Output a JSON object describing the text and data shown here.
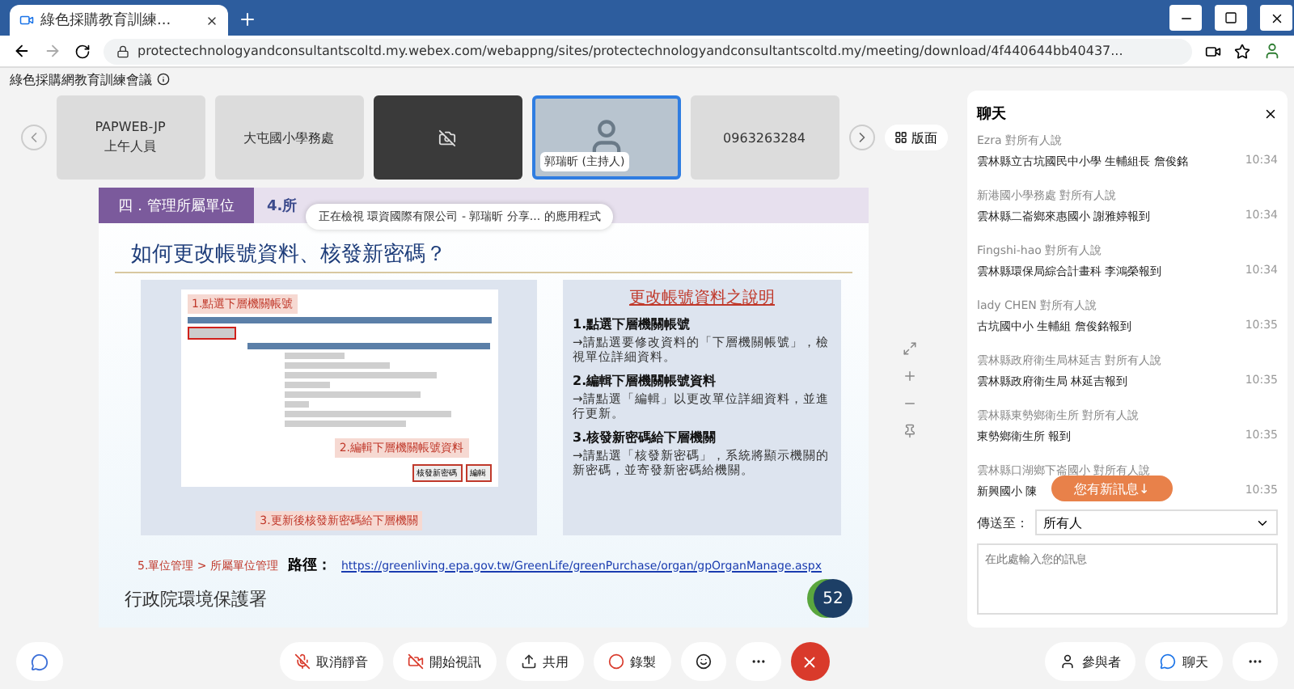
{
  "browser": {
    "tab_title": "綠色採購教育訓練...",
    "url": "protectechnologyandconsultantscoltd.my.webex.com/webappng/sites/protectechnologyandconsultantscoltd.my/meeting/download/4f440644bb40437..."
  },
  "meeting": {
    "title": "綠色採購網教育訓練會議"
  },
  "participants": [
    {
      "kind": "name",
      "name": "PAPWEB-JP",
      "subtitle": "上午人員"
    },
    {
      "kind": "name",
      "name": "大屯國小學務處"
    },
    {
      "kind": "camera_off"
    },
    {
      "kind": "video",
      "name": "郭瑞昕 (主持人)",
      "selected": true
    },
    {
      "kind": "name",
      "name": "0963263284"
    }
  ],
  "layout_button": "版面",
  "share_banner": "正在檢視 環資國際有限公司 - 郭瑞昕 分享... 的應用程式",
  "slide": {
    "breadcrumb": [
      "四．管理所屬單位",
      "4.所"
    ],
    "title": "如何更改帳號資料、核發新密碼？",
    "callouts": [
      "1.點選下層機關帳號",
      "2.編輯下層機關帳號資料",
      "3.更新後核發新密碼給下層機關"
    ],
    "screen_buttons": [
      "核發新密碼",
      "編輯"
    ],
    "help_title": "更改帳號資料之說明",
    "steps": [
      {
        "heading": "1.點選下層機關帳號",
        "text": "→請點選要修改資料的「下層機關帳號」，檢視單位詳細資料。"
      },
      {
        "heading": "2.編輯下層機關帳號資料",
        "text": "→請點選「編輯」以更改單位詳細資料，並進行更新。"
      },
      {
        "heading": "3.核發新密碼給下層機關",
        "text": "→請點選「核發新密碼」，系統將顯示機關的新密碼，並寄發新密碼給機關。"
      }
    ],
    "menu_path": "5.單位管理 > 所屬單位管理",
    "path_label": "路徑：",
    "link": "https://greenliving.epa.gov.tw/GreenLife/greenPurchase/organ/gpOrganManage.aspx",
    "agency": "行政院環境保護署",
    "page": "52"
  },
  "chat": {
    "title": "聊天",
    "messages": [
      {
        "from": "Ezra 對所有人說",
        "text": "雲林縣立古坑國民中小學 生輔組長 詹俊銘",
        "time": "10:34"
      },
      {
        "from": "新港國小學務處 對所有人說",
        "text": "雲林縣二崙鄉來惠國小 謝雅婷報到",
        "time": "10:34"
      },
      {
        "from": "Fingshi-hao 對所有人說",
        "text": "雲林縣環保局綜合計畫科 李鴻榮報到",
        "time": "10:34"
      },
      {
        "from": "lady CHEN 對所有人說",
        "text": "古坑國中小 生輔組 詹俊銘報到",
        "time": "10:35"
      },
      {
        "from": "雲林縣政府衛生局林延吉 對所有人說",
        "text": "雲林縣政府衛生局 林延吉報到",
        "time": "10:35"
      },
      {
        "from": "雲林縣東勢鄉衛生所 對所有人說",
        "text": "東勢鄉衛生所 報到",
        "time": "10:35"
      },
      {
        "from": "雲林縣口湖鄉下崙國小 對所有人說",
        "text": "新興國小 陳",
        "time": "10:35"
      }
    ],
    "new_message": "您有新訊息↓",
    "send_to_label": "傳送至：",
    "send_to": "所有人",
    "placeholder": "在此處輸入您的訊息"
  },
  "toolbar": [
    {
      "kind": "mic",
      "label": "取消靜音"
    },
    {
      "kind": "video",
      "label": "開始視訊"
    },
    {
      "kind": "share",
      "label": "共用"
    },
    {
      "kind": "record",
      "label": "錄製"
    }
  ],
  "right_toolbar": [
    "參與者",
    "聊天"
  ]
}
